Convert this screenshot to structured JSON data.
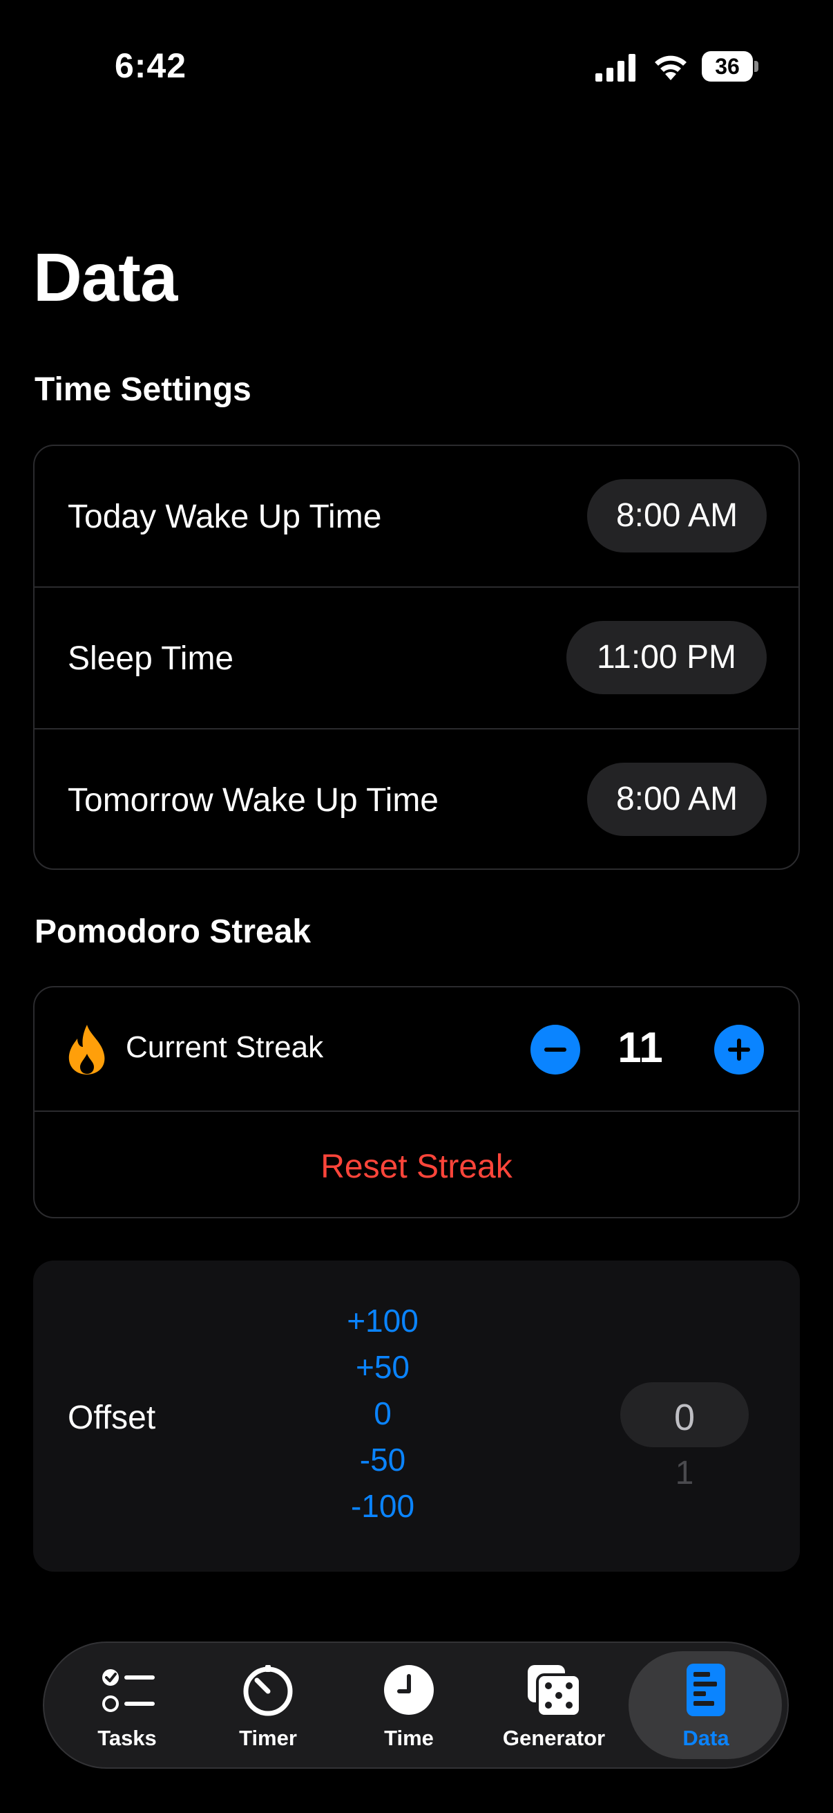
{
  "status_bar": {
    "time": "6:42",
    "battery": "36"
  },
  "page": {
    "title": "Data"
  },
  "time_settings": {
    "header": "Time Settings",
    "rows": [
      {
        "label": "Today Wake Up Time",
        "value": "8:00 AM"
      },
      {
        "label": "Sleep Time",
        "value": "11:00 PM"
      },
      {
        "label": "Tomorrow Wake Up Time",
        "value": "8:00 AM"
      }
    ]
  },
  "streak": {
    "header": "Pomodoro Streak",
    "label": "Current Streak",
    "value": "11",
    "reset_label": "Reset Streak",
    "icon": "flame-icon"
  },
  "offset": {
    "label": "Offset",
    "options": [
      "+100",
      "+50",
      "0",
      "-50",
      "-100"
    ],
    "picker_selected": "0",
    "picker_next": "1"
  },
  "tabs": [
    {
      "label": "Tasks",
      "icon": "checklist-icon"
    },
    {
      "label": "Timer",
      "icon": "timer-icon"
    },
    {
      "label": "Time",
      "icon": "clock-icon"
    },
    {
      "label": "Generator",
      "icon": "dice-icon"
    },
    {
      "label": "Data",
      "icon": "chart-icon",
      "active": true
    }
  ],
  "colors": {
    "accent": "#0a84ff",
    "destructive": "#ff453a",
    "flame": "#ff9f0a"
  }
}
